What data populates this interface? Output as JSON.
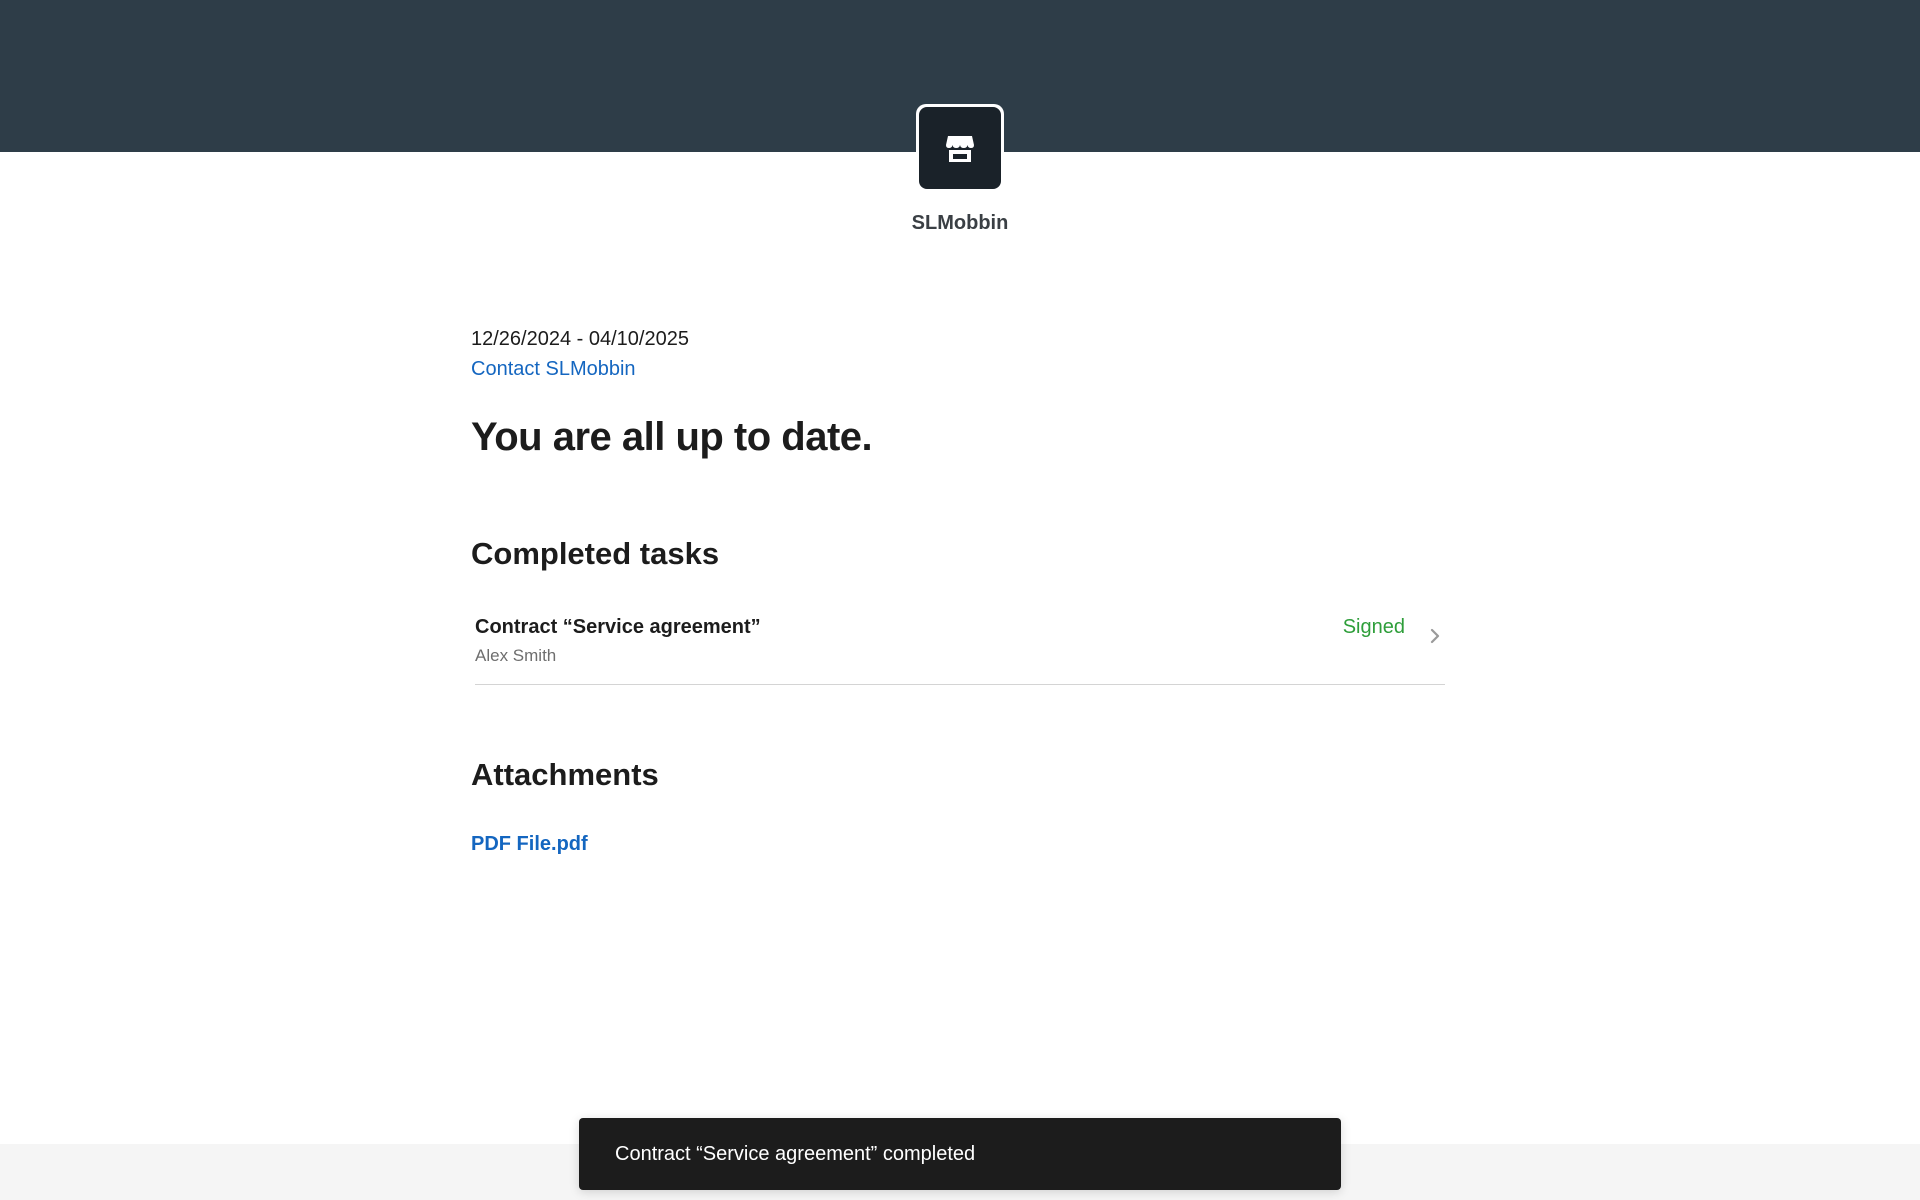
{
  "brand": {
    "name": "SLMobbin",
    "logo_icon": "storefront-icon",
    "header_color": "#2e3d48"
  },
  "summary": {
    "date_range": "12/26/2024 - 04/10/2025",
    "contact_link": "Contact SLMobbin",
    "headline": "You are all up to date."
  },
  "completed": {
    "title": "Completed tasks",
    "tasks": [
      {
        "name": "Contract “Service agreement”",
        "person": "Alex Smith",
        "status": "Signed",
        "status_color": "#2e9e3a",
        "icon": "chevron-right-icon"
      }
    ]
  },
  "attachments": {
    "title": "Attachments",
    "files": [
      {
        "name": "PDF File.pdf"
      }
    ]
  },
  "toast": {
    "message": "Contract “Service agreement” completed"
  }
}
